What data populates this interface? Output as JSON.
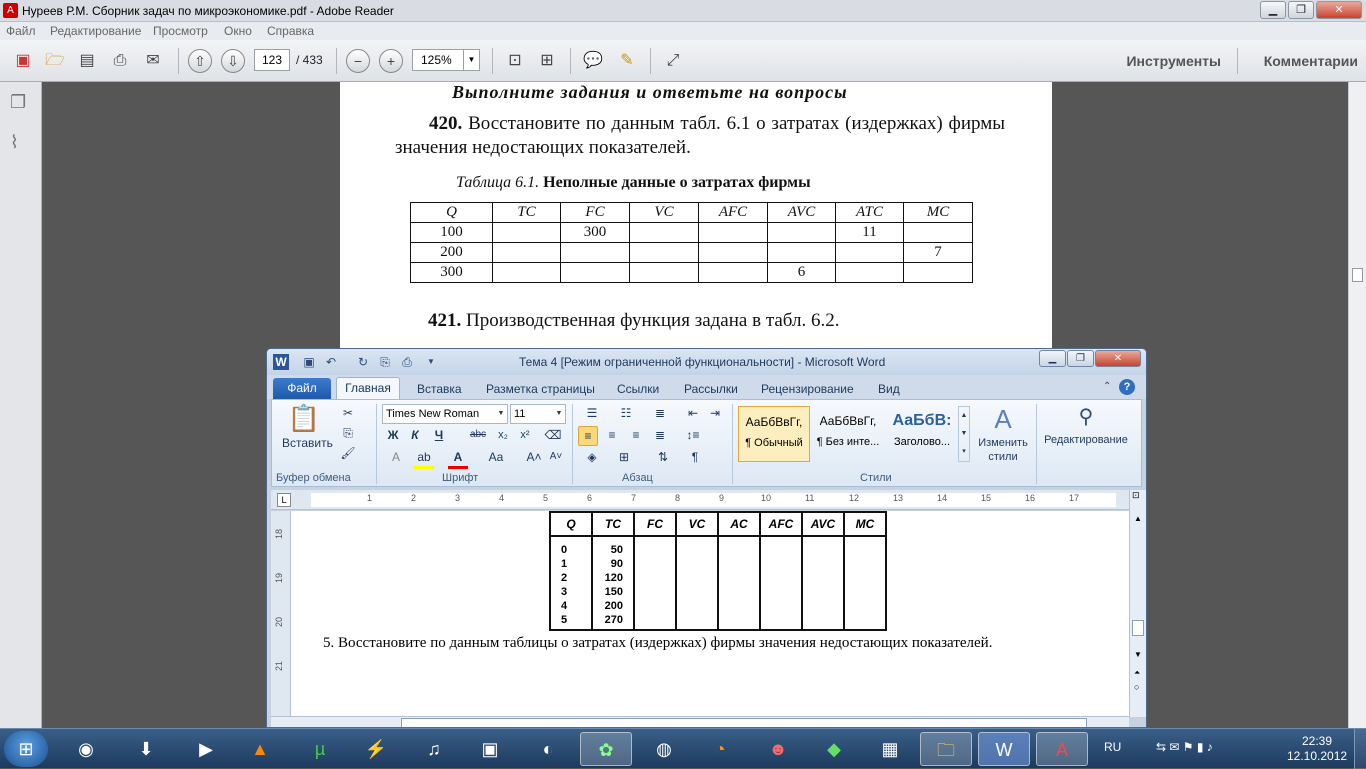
{
  "adobe": {
    "title": "Нуреев Р.М. Сборник задач по микроэкономике.pdf - Adobe Reader",
    "menu": [
      "Файл",
      "Редактирование",
      "Просмотр",
      "Окно",
      "Справка"
    ],
    "page_current": "123",
    "page_total": "/ 433",
    "zoom": "125%",
    "tools_label": "Инструменты",
    "comments_label": "Комментарии"
  },
  "pdf": {
    "heading": "Выполните задания и ответьте на вопросы",
    "task420_num": "420.",
    "task420_text": "Восстановите по данным табл. 6.1 о затратах (издержках) фирмы значения недостающих показателей.",
    "table_caption_italic": "Таблица 6.1.",
    "table_caption_bold": "Неполные данные о затратах фирмы",
    "table_headers": [
      "Q",
      "TC",
      "FC",
      "VC",
      "AFC",
      "AVC",
      "ATC",
      "MC"
    ],
    "table_rows": [
      [
        "100",
        "",
        "300",
        "",
        "",
        "",
        "11",
        ""
      ],
      [
        "200",
        "",
        "",
        "",
        "",
        "",
        "",
        "7"
      ],
      [
        "300",
        "",
        "",
        "",
        "",
        "6",
        "",
        ""
      ]
    ],
    "task421_num": "421.",
    "task421_text": "Производственная функция задана в табл. 6.2."
  },
  "word": {
    "title": "Тема 4 [Режим ограниченной функциональности] - Microsoft Word",
    "tabs": [
      "Файл",
      "Главная",
      "Вставка",
      "Разметка страницы",
      "Ссылки",
      "Рассылки",
      "Рецензирование",
      "Вид"
    ],
    "font_name": "Times New Roman",
    "font_size": "11",
    "paste_label": "Вставить",
    "groups": {
      "clipboard": "Буфер обмена",
      "font": "Шрифт",
      "paragraph": "Абзац",
      "styles": "Стили"
    },
    "styles": [
      {
        "preview": "АаБбВвГг,",
        "name": "¶ Обычный"
      },
      {
        "preview": "АаБбВвГг,",
        "name": "¶ Без инте..."
      },
      {
        "preview": "АаБбВ:",
        "name": "Заголово..."
      }
    ],
    "change_styles": "Изменить стили",
    "editing": "Редактирование",
    "ruler_numbers": [
      "1",
      "2",
      "3",
      "4",
      "5",
      "6",
      "7",
      "8",
      "9",
      "10",
      "11",
      "12",
      "13",
      "14",
      "15",
      "16",
      "17"
    ],
    "left_ruler_numbers": [
      "18",
      "19",
      "20",
      "21"
    ],
    "table_headers": [
      "Q",
      "TC",
      "FC",
      "VC",
      "AC",
      "AFC",
      "AVC",
      "MC"
    ],
    "table_q": "0\n1\n2\n3\n4\n5",
    "table_tc": "50\n90\n120\n150\n200\n270",
    "paragraph": "5. Восстановите по данным таблицы о затратах (издержках) фирмы значения недостающих показателей."
  },
  "taskbar": {
    "lang": "RU",
    "time": "22:39",
    "date": "12.10.2012"
  }
}
